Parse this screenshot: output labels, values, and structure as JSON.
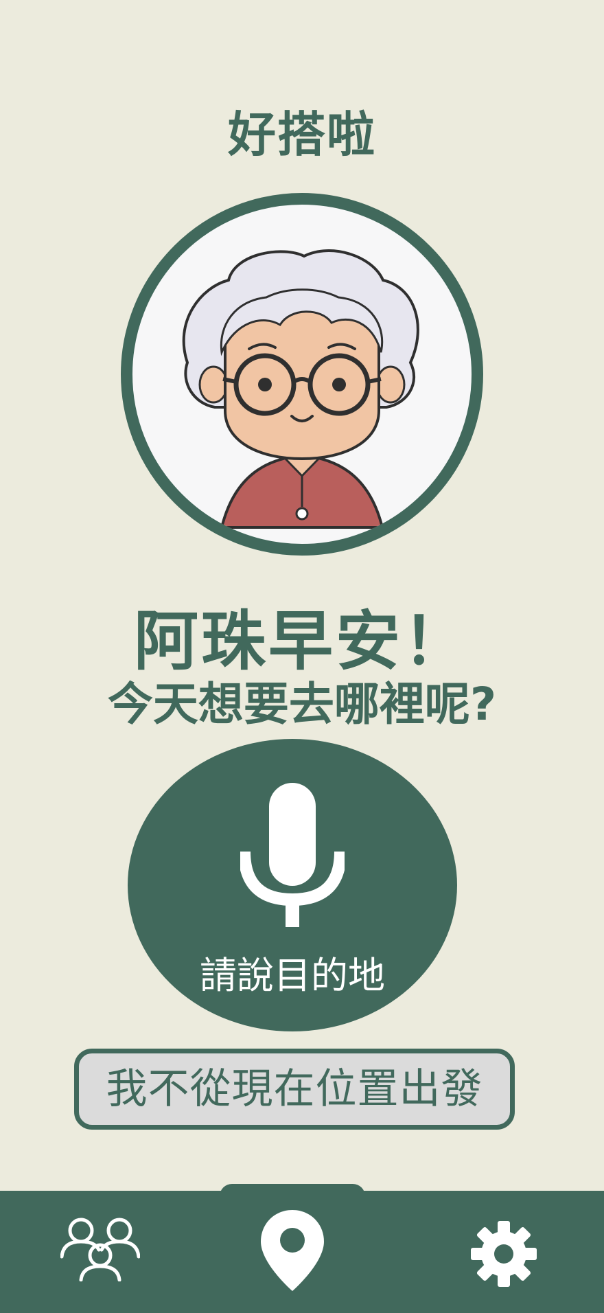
{
  "app": {
    "title": "好搭啦"
  },
  "profile": {
    "avatar_icon": "grandma-avatar"
  },
  "greeting": {
    "line1": "阿珠早安！",
    "line2": "今天想要去哪裡呢?"
  },
  "voice": {
    "label": "請說目的地",
    "icon": "microphone-icon"
  },
  "actions": {
    "alt_start": "我不從現在位置出發"
  },
  "nav": {
    "items": [
      {
        "icon": "people-icon",
        "active": false
      },
      {
        "icon": "location-pin-icon",
        "active": true
      },
      {
        "icon": "gear-icon",
        "active": false
      }
    ]
  },
  "colors": {
    "primary": "#41695c",
    "background": "#ecebdd",
    "button_fill": "#dbdbdb",
    "avatar_bg": "#f7f7f8"
  }
}
